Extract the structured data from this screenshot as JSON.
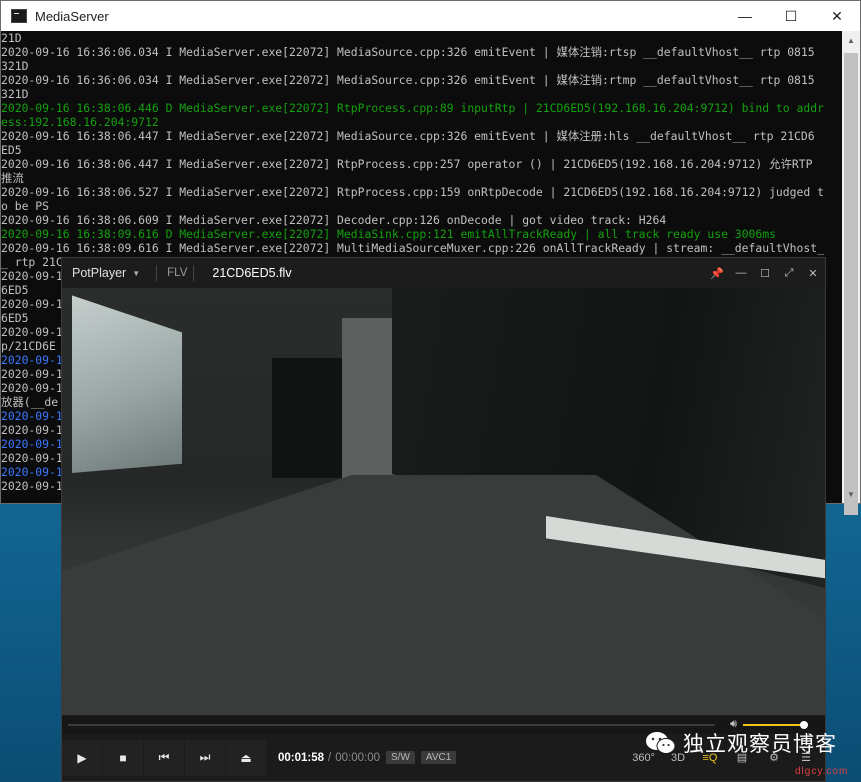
{
  "console": {
    "title": "MediaServer",
    "controls": {
      "minimize": "—",
      "maximize": "☐",
      "close": "✕"
    },
    "lines": [
      {
        "text": "21D",
        "color": "white"
      },
      {
        "text": "2020-09-16 16:36:06.034 I MediaServer.exe[22072] MediaSource.cpp:326 emitEvent | 媒体注销:rtsp __defaultVhost__ rtp 0815",
        "color": "white"
      },
      {
        "text": "321D",
        "color": "white"
      },
      {
        "text": "2020-09-16 16:36:06.034 I MediaServer.exe[22072] MediaSource.cpp:326 emitEvent | 媒体注销:rtmp __defaultVhost__ rtp 0815",
        "color": "white"
      },
      {
        "text": "321D",
        "color": "white"
      },
      {
        "text": "2020-09-16 16:38:06.446 D MediaServer.exe[22072] RtpProcess.cpp:89 inputRtp | 21CD6ED5(192.168.16.204:9712) bind to addr",
        "color": "green"
      },
      {
        "text": "ess:192.168.16.204:9712",
        "color": "green"
      },
      {
        "text": "2020-09-16 16:38:06.447 I MediaServer.exe[22072] MediaSource.cpp:326 emitEvent | 媒体注册:hls __defaultVhost__ rtp 21CD6",
        "color": "white"
      },
      {
        "text": "ED5",
        "color": "white"
      },
      {
        "text": "2020-09-16 16:38:06.447 I MediaServer.exe[22072] RtpProcess.cpp:257 operator () | 21CD6ED5(192.168.16.204:9712) 允许RTP",
        "color": "white"
      },
      {
        "text": "推流",
        "color": "white"
      },
      {
        "text": "2020-09-16 16:38:06.527 I MediaServer.exe[22072] RtpProcess.cpp:159 onRtpDecode | 21CD6ED5(192.168.16.204:9712) judged t",
        "color": "white"
      },
      {
        "text": "o be PS",
        "color": "white"
      },
      {
        "text": "2020-09-16 16:38:06.609 I MediaServer.exe[22072] Decoder.cpp:126 onDecode | got video track: H264",
        "color": "white"
      },
      {
        "text": "2020-09-16 16:38:09.616 D MediaServer.exe[22072] MediaSink.cpp:121 emitAllTrackReady | all track ready use 3006ms",
        "color": "green"
      },
      {
        "text": "2020-09-16 16:38:09.616 I MediaServer.exe[22072] MultiMediaSourceMuxer.cpp:226 onAllTrackReady | stream: __defaultVhost_",
        "color": "white"
      },
      {
        "text": "_ rtp 21C",
        "color": "white"
      },
      {
        "text": "2020-09-1                                                                                                        CD",
        "color": "white"
      },
      {
        "text": "6ED5",
        "color": "white"
      },
      {
        "text": "2020-09-1                                                                                                        CD",
        "color": "white"
      },
      {
        "text": "6ED5",
        "color": "white"
      },
      {
        "text": "2020-09-1                                                                                                        rt",
        "color": "white"
      },
      {
        "text": "p/21CD6E",
        "color": "white"
      },
      {
        "text": "2020-09-1",
        "color": "blue"
      },
      {
        "text": "2020-09-1",
        "color": "white"
      },
      {
        "text": "2020-09-1                                                                                                        播",
        "color": "white"
      },
      {
        "text": "放器(__de",
        "color": "white"
      },
      {
        "text": "2020-09-1",
        "color": "blue"
      },
      {
        "text": "2020-09-1",
        "color": "white"
      },
      {
        "text": "2020-09-1",
        "color": "blue"
      },
      {
        "text": "2020-09-1",
        "color": "white"
      },
      {
        "text": "2020-09-1",
        "color": "blue"
      },
      {
        "text": "2020-09-1                                                                                                        播",
        "color": "white"
      }
    ]
  },
  "player": {
    "menu_label": "PotPlayer",
    "format": "FLV",
    "filename": "21CD6ED5.flv",
    "time_current": "00:01:58",
    "time_separator": "/",
    "time_duration": "00:00:00",
    "tag_sw": "S/W",
    "tag_codec": "AVC1",
    "volume_level": 0.95,
    "buttons": {
      "play": "▶",
      "stop": "■",
      "prev": "⏮",
      "next": "⏭",
      "eject": "⏏"
    },
    "right_icons": [
      "360°",
      "3D",
      "≡Q",
      "▤",
      "⚙",
      "☰"
    ],
    "title_controls": [
      "📌",
      "—",
      "☐",
      "⤢",
      "✕"
    ]
  },
  "watermark": {
    "text": "独立观察员博客",
    "url": "dlgcy.com"
  }
}
